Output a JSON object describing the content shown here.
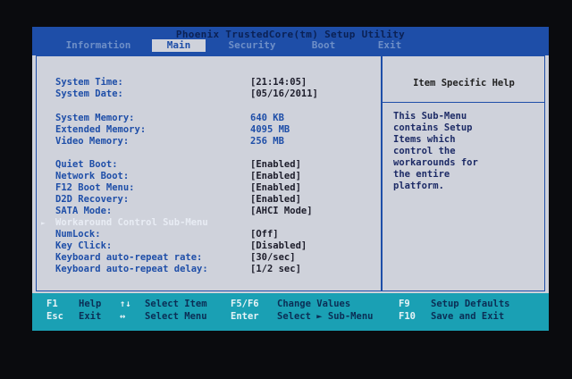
{
  "title": "Phoenix TrustedCore(tm) Setup Utility",
  "tabs": [
    {
      "label": "Information"
    },
    {
      "label": "Main"
    },
    {
      "label": "Security"
    },
    {
      "label": "Boot"
    },
    {
      "label": "Exit"
    }
  ],
  "active_tab": "Main",
  "settings": [
    {
      "label": "System Time:",
      "value": "[21:14:05]"
    },
    {
      "label": "System Date:",
      "value": "[05/16/2011]"
    },
    {
      "label": "System Memory:",
      "value": "640 KB"
    },
    {
      "label": "Extended Memory:",
      "value": "4095 MB"
    },
    {
      "label": "Video Memory:",
      "value": "256 MB"
    },
    {
      "label": "Quiet Boot:",
      "value": "[Enabled]"
    },
    {
      "label": "Network Boot:",
      "value": "[Enabled]"
    },
    {
      "label": "F12 Boot Menu:",
      "value": "[Enabled]"
    },
    {
      "label": "D2D Recovery:",
      "value": "[Enabled]"
    },
    {
      "label": "SATA Mode:",
      "value": "[AHCI Mode]"
    },
    {
      "label": "Workaround Control Sub-Menu",
      "value": ""
    },
    {
      "label": "NumLock:",
      "value": "[Off]"
    },
    {
      "label": "Key Click:",
      "value": "[Disabled]"
    },
    {
      "label": "Keyboard auto-repeat rate:",
      "value": "[30/sec]"
    },
    {
      "label": "Keyboard auto-repeat delay:",
      "value": "[1/2 sec]"
    }
  ],
  "help": {
    "title": "Item Specific Help",
    "text": [
      "This Sub-Menu",
      "contains Setup",
      "Items which",
      "control the",
      "workarounds for",
      "the entire",
      "platform."
    ]
  },
  "statusbar": {
    "f1": "F1",
    "help": "Help",
    "updown": "↑↓",
    "select_item": "Select Item",
    "f5f6": "F5/F6",
    "change_values": "Change Values",
    "f9": "F9",
    "setup_defaults": "Setup Defaults",
    "esc": "Esc",
    "exit": "Exit",
    "leftright": "↔",
    "select_menu": "Select Menu",
    "enter": "Enter",
    "select_submenu": "Select ► Sub-Menu",
    "f10": "F10",
    "save_and_exit": "Save and Exit"
  },
  "colors": {
    "accent": "#1e4ea8",
    "background": "#cfd2db",
    "statusbar": "#1aa0b4"
  },
  "icons": {
    "submenu_arrow": "triangle-right-icon"
  }
}
